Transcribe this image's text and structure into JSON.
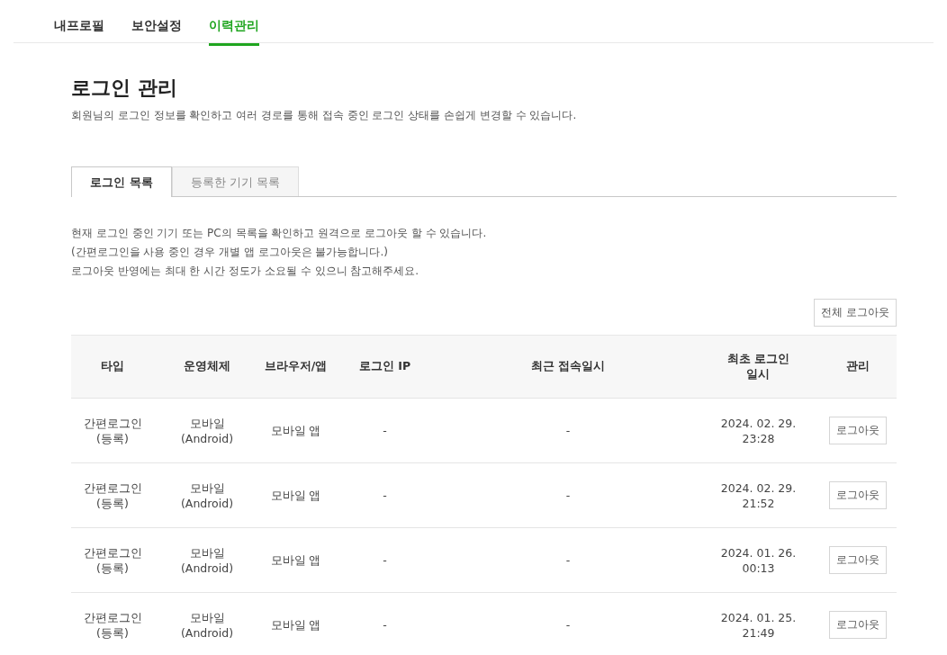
{
  "top_tabs": [
    {
      "label": "내프로필",
      "selected": false
    },
    {
      "label": "보안설정",
      "selected": false
    },
    {
      "label": "이력관리",
      "selected": true
    }
  ],
  "title": "로그인 관리",
  "subtitle": "회원님의 로그인 정보를 확인하고 여러 경로를 통해 접속 중인 로그인 상태를 손쉽게 변경할 수 있습니다.",
  "sub_tabs": [
    {
      "label": "로그인 목록",
      "selected": true
    },
    {
      "label": "등록한 기기 목록",
      "selected": false
    }
  ],
  "notes": [
    "현재 로그인 중인 기기 또는 PC의 목록을 확인하고 원격으로 로그아웃 할 수 있습니다.",
    "(간편로그인을 사용 중인 경우 개별 앱 로그아웃은 불가능합니다.)",
    "로그아웃 반영에는 최대 한 시간 정도가 소요될 수 있으니 참고해주세요."
  ],
  "logout_all_button": "전체 로그아웃",
  "table": {
    "columns": [
      "타입",
      "운영체제",
      "브라우저/앱",
      "로그인 IP",
      "최근 접속일시",
      "최초 로그인\n일시",
      "관리"
    ],
    "rows": [
      {
        "type": "간편로그인\n(등록)",
        "os": "모바일\n(Android)",
        "browser": "모바일 앱",
        "ip": "-",
        "recent": "-",
        "first": "2024. 02. 29.\n23:28",
        "action": "로그아웃"
      },
      {
        "type": "간편로그인\n(등록)",
        "os": "모바일\n(Android)",
        "browser": "모바일 앱",
        "ip": "-",
        "recent": "-",
        "first": "2024. 02. 29.\n21:52",
        "action": "로그아웃"
      },
      {
        "type": "간편로그인\n(등록)",
        "os": "모바일\n(Android)",
        "browser": "모바일 앱",
        "ip": "-",
        "recent": "-",
        "first": "2024. 01. 26.\n00:13",
        "action": "로그아웃"
      },
      {
        "type": "간편로그인\n(등록)",
        "os": "모바일\n(Android)",
        "browser": "모바일 앱",
        "ip": "-",
        "recent": "-",
        "first": "2024. 01. 25.\n21:49",
        "action": "로그아웃"
      }
    ]
  }
}
